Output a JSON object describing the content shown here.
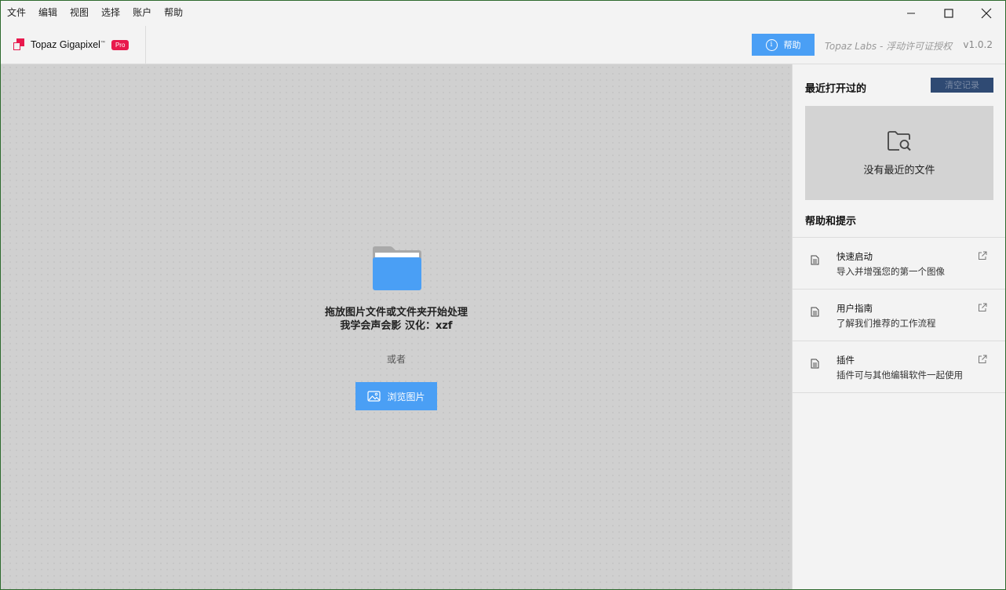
{
  "menu": [
    "文件",
    "编辑",
    "视图",
    "选择",
    "账户",
    "帮助"
  ],
  "window_controls": {
    "minimize": "—",
    "maximize": "☐",
    "close": "✕"
  },
  "brand": {
    "name": "Topaz Gigapixel",
    "tm": "™",
    "badge": "Pro"
  },
  "header": {
    "help_label": "帮助",
    "license": "Topaz Labs - 浮动许可证授权",
    "version": "v1.0.2"
  },
  "drop_area": {
    "line1": "拖放图片文件或文件夹开始处理",
    "line2": "我学会声会影 汉化：xzf",
    "or": "或者",
    "browse_label": "浏览图片"
  },
  "sidebar": {
    "recent_title": "最近打开过的",
    "clear_label": "清空记录",
    "no_recent": "没有最近的文件",
    "help_title": "帮助和提示",
    "items": [
      {
        "title": "快速启动",
        "desc": "导入并增强您的第一个图像"
      },
      {
        "title": "用户指南",
        "desc": "了解我们推荐的工作流程"
      },
      {
        "title": "插件",
        "desc": "插件可与其他编辑软件一起使用"
      }
    ]
  },
  "colors": {
    "accent": "#4a9ff5",
    "brand": "#e8194d",
    "clear_button": "#2f4a73"
  }
}
